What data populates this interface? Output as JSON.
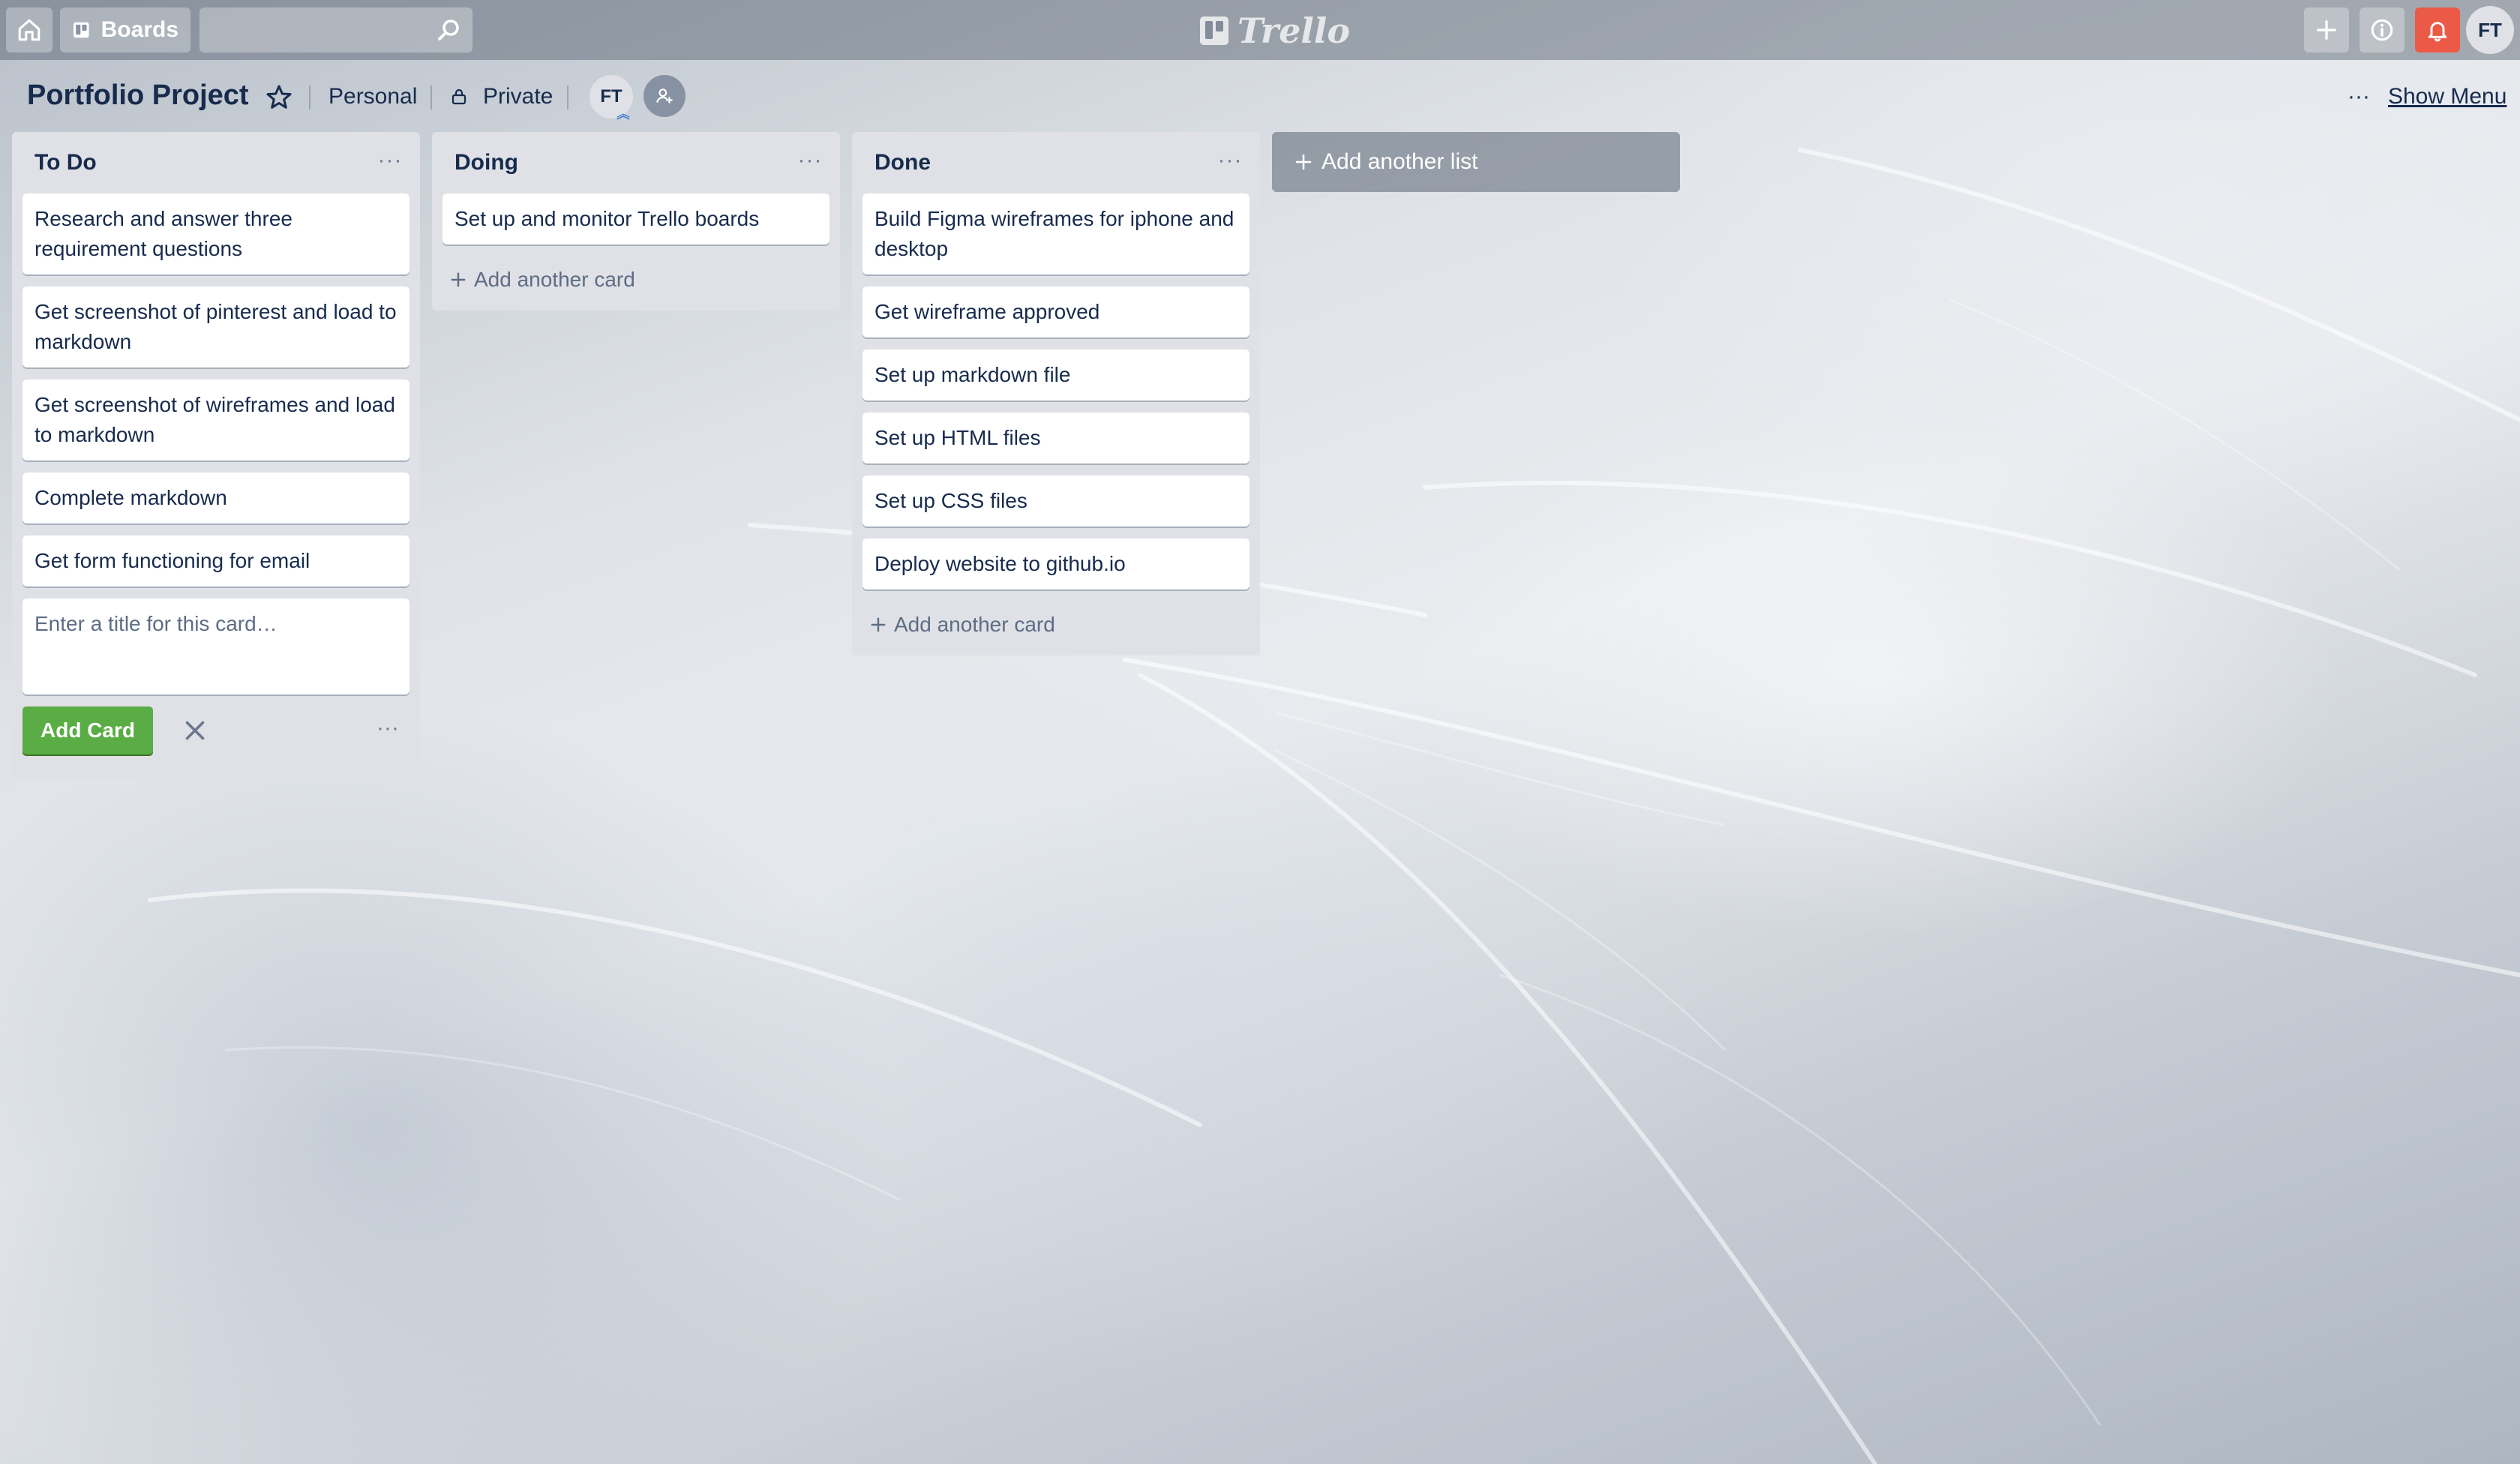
{
  "header": {
    "boards_label": "Boards",
    "search_placeholder": "",
    "logo_text": "Trello",
    "user_initials": "FT",
    "icons": [
      "home-icon",
      "board-icon",
      "search-icon",
      "plus-icon",
      "info-icon",
      "bell-icon"
    ],
    "bell_color": "#eb5a46"
  },
  "board": {
    "title": "Portfolio Project",
    "team": "Personal",
    "visibility": "Private",
    "member_initials": "FT",
    "show_menu_label": "Show Menu"
  },
  "lists": [
    {
      "title": "To Do",
      "cards": [
        "Research and answer three requirement questions",
        "Get screenshot of pinterest and load to markdown",
        "Get screenshot of wireframes and load to markdown",
        "Complete markdown",
        "Get form functioning for email"
      ],
      "composer_placeholder": "Enter a title for this card…",
      "add_card_button": "Add Card"
    },
    {
      "title": "Doing",
      "cards": [
        "Set up and monitor Trello boards"
      ],
      "add_card_label": "Add another card"
    },
    {
      "title": "Done",
      "cards": [
        "Build Figma wireframes for iphone and desktop",
        "Get wireframe approved",
        "Set up markdown file",
        "Set up HTML files",
        "Set up CSS files",
        "Deploy website to github.io"
      ],
      "add_card_label": "Add another card"
    }
  ],
  "add_list_label": "Add another list",
  "colors": {
    "list_bg": "#dfe1e6",
    "add_card_green": "#5aac44",
    "text": "#172b4d"
  }
}
